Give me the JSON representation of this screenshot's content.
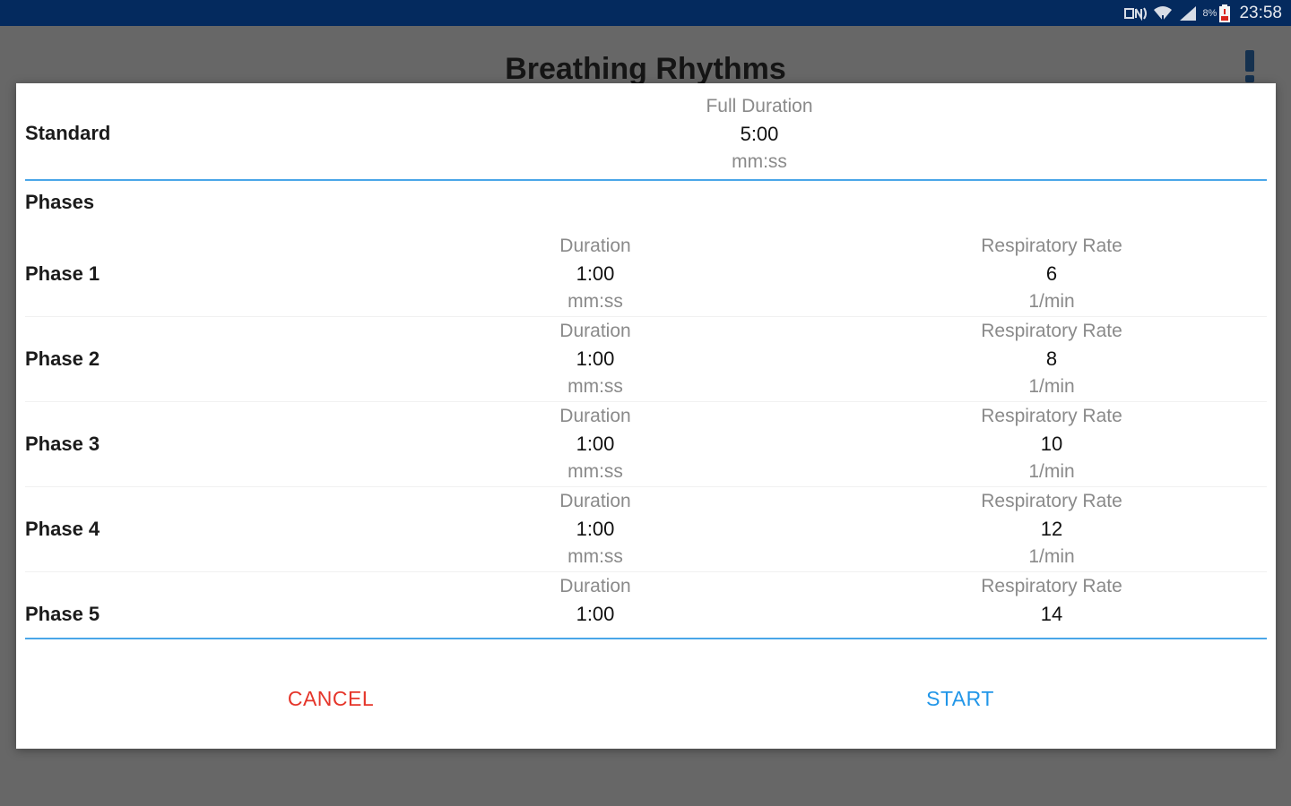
{
  "status_bar": {
    "time": "23:58",
    "icons": [
      "nfc-icon",
      "wifi-icon",
      "signal-icon",
      "battery-low-icon"
    ],
    "battery_text": "8%"
  },
  "app": {
    "title": "Breathing Rhythms",
    "alert_icon": "exclamation-icon"
  },
  "dialog": {
    "standard": {
      "label": "Standard",
      "full_duration_caption": "Full Duration",
      "full_duration_value": "5:00",
      "full_duration_unit": "mm:ss"
    },
    "phases_heading": "Phases",
    "phases": [
      {
        "label": "Phase 1",
        "duration_caption": "Duration",
        "duration": "1:00",
        "duration_unit": "mm:ss",
        "rate_caption": "Respiratory Rate",
        "rate": "6",
        "rate_unit": "1/min"
      },
      {
        "label": "Phase 2",
        "duration_caption": "Duration",
        "duration": "1:00",
        "duration_unit": "mm:ss",
        "rate_caption": "Respiratory Rate",
        "rate": "8",
        "rate_unit": "1/min"
      },
      {
        "label": "Phase 3",
        "duration_caption": "Duration",
        "duration": "1:00",
        "duration_unit": "mm:ss",
        "rate_caption": "Respiratory Rate",
        "rate": "10",
        "rate_unit": "1/min"
      },
      {
        "label": "Phase 4",
        "duration_caption": "Duration",
        "duration": "1:00",
        "duration_unit": "mm:ss",
        "rate_caption": "Respiratory Rate",
        "rate": "12",
        "rate_unit": "1/min"
      },
      {
        "label": "Phase 5",
        "duration_caption": "Duration",
        "duration": "1:00",
        "duration_unit": "",
        "rate_caption": "Respiratory Rate",
        "rate": "14",
        "rate_unit": ""
      }
    ],
    "buttons": {
      "cancel": "CANCEL",
      "start": "START"
    }
  },
  "colors": {
    "status_bar": "#042a5e",
    "accent_line": "#4aa6e8",
    "cancel": "#e5352a",
    "start": "#2196e8",
    "scrim": "#676767"
  }
}
